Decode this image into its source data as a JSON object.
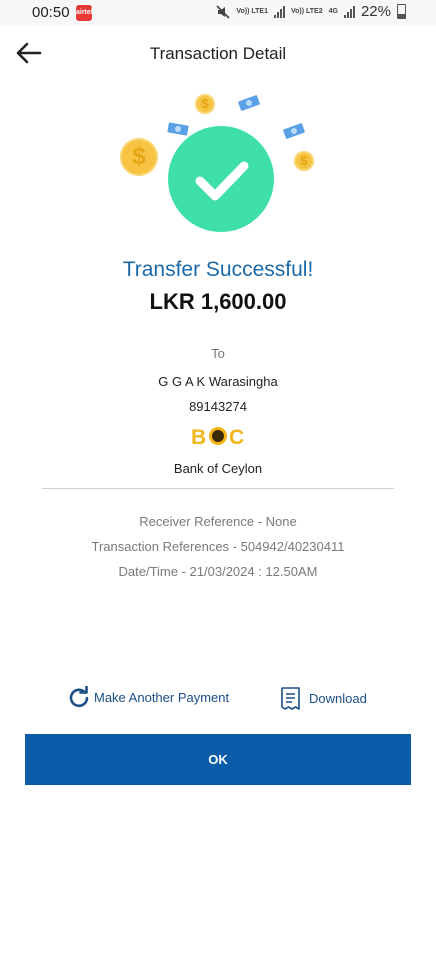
{
  "status_bar": {
    "time": "00:50",
    "app_badge": "airtel",
    "network1": "Vo)) LTE1",
    "network2": "Vo)) LTE2",
    "network_type": "4G",
    "battery": "22%"
  },
  "header": {
    "title": "Transaction Detail",
    "back_icon": "arrow-left-icon"
  },
  "result": {
    "headline": "Transfer Successful!",
    "amount": "LKR 1,600.00",
    "icon": "checkmark-circle-icon"
  },
  "recipient": {
    "to_label": "To",
    "name": "G G A K Warasingha",
    "account_number": "89143274",
    "bank_logo_text": "BOC",
    "bank_name": "Bank of Ceylon"
  },
  "details": {
    "receiver_reference": "Receiver Reference - None",
    "transaction_references": "Transaction References - 504942/40230411",
    "datetime": "Date/Time - 21/03/2024 : 12.50AM"
  },
  "actions": {
    "make_another_payment": "Make Another Payment",
    "download": "Download",
    "ok": "OK"
  },
  "colors": {
    "primary_blue": "#0a5ca8",
    "headline_blue": "#1b69a8",
    "success_green": "#3fe0a8",
    "coin_gold": "#f6c342",
    "boc_gold": "#f2b619"
  }
}
